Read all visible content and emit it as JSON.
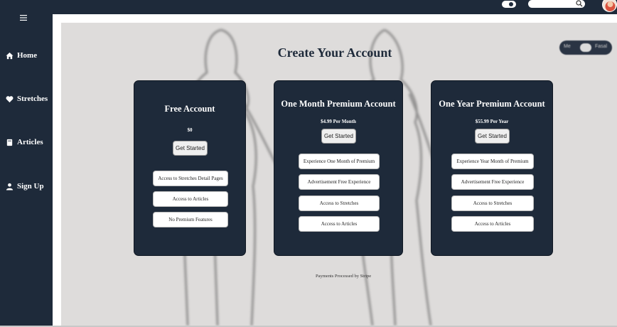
{
  "header": {
    "search": {
      "placeholder": "",
      "icon": "search-icon"
    },
    "theme_toggle": "toggle-icon",
    "avatar": "avatar"
  },
  "sidebar": {
    "menu_icon": "hamburger-icon",
    "items": [
      {
        "label": "Home",
        "icon": "home-icon"
      },
      {
        "label": "Stretches",
        "icon": "heart-icon"
      },
      {
        "label": "Articles",
        "icon": "book-icon"
      },
      {
        "label": "Sign Up",
        "icon": "user-icon"
      }
    ]
  },
  "units_toggle": {
    "left": "Me",
    "right": "Fasal"
  },
  "page": {
    "title": "Create Your Account",
    "footer": "Payments Processed by Stripe"
  },
  "plans": [
    {
      "title": "Free Account",
      "price": "$0",
      "button": "Get Started",
      "features": [
        "Access to Stretches Detail Pages",
        "Access to Articles",
        "No Premium Features"
      ]
    },
    {
      "title": "One Month Premium Account",
      "price": "$4.99 Per Month",
      "button": "Get Started",
      "features": [
        "Experience One Month of Premium",
        "Advertisement Free Experience",
        "Access to Stretches",
        "Access to Articles"
      ]
    },
    {
      "title": "One Year Premium Account",
      "price": "$55.99 Per Year",
      "button": "Get Started",
      "features": [
        "Experience Year Month of Premium",
        "Advertisement Free Experience",
        "Access to Stretches",
        "Access to Articles"
      ]
    }
  ],
  "colors": {
    "navy": "#1e2a3a",
    "background": "#dedcdb",
    "card_text": "#ffffff"
  }
}
